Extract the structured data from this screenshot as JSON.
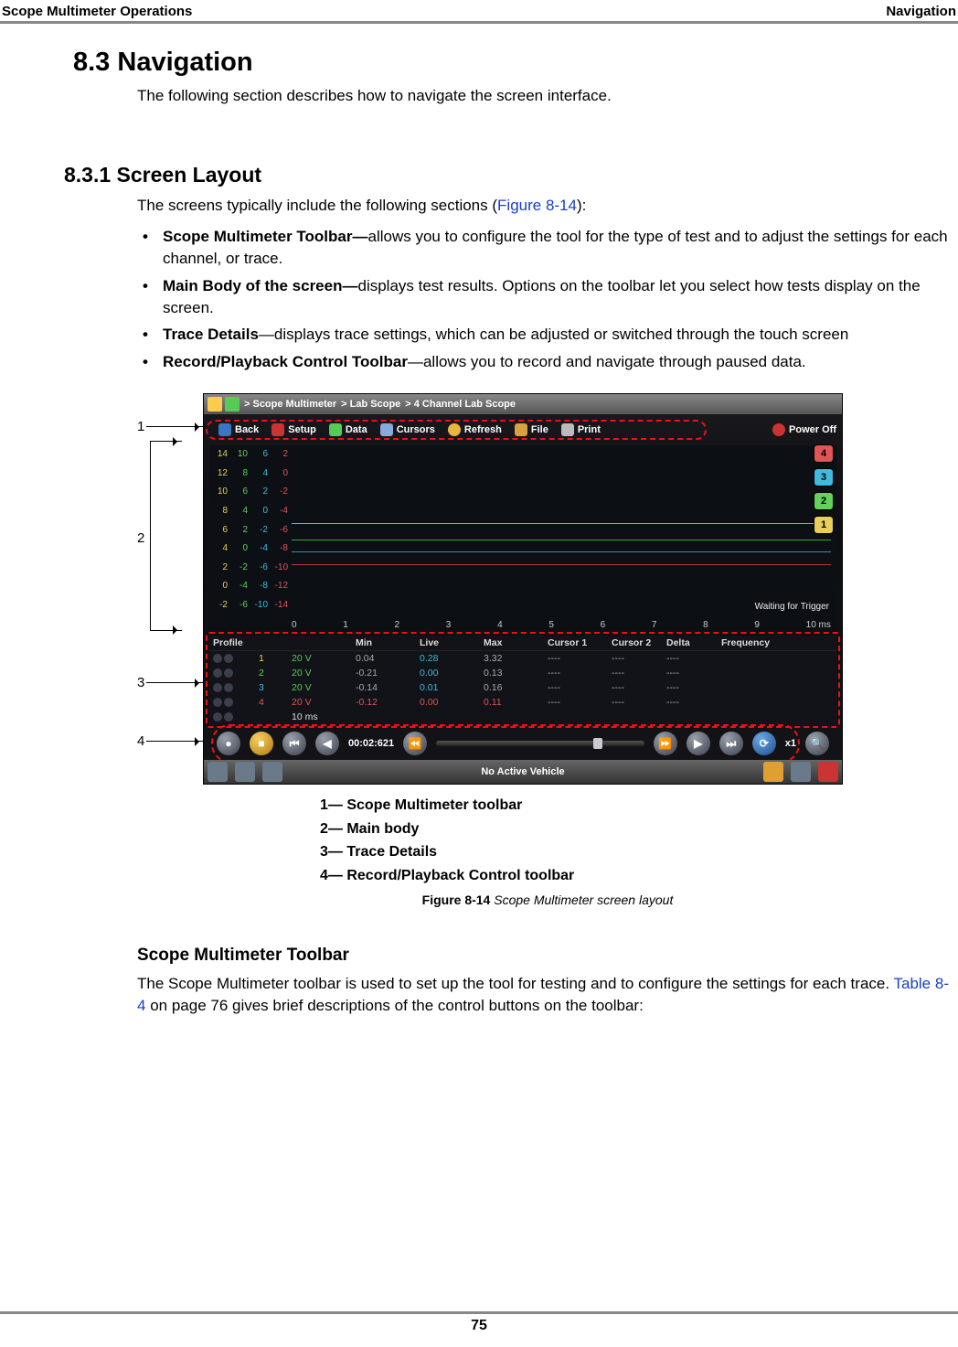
{
  "page_header": {
    "left": "Scope Multimeter Operations",
    "right": "Navigation"
  },
  "page_number": "75",
  "h_section": "8.3   Navigation",
  "p_section_intro": "The following section describes how to navigate the screen interface.",
  "h_sub": "8.3.1   Screen Layout",
  "p_sub_intro_pre": "The screens typically include the following sections (",
  "p_sub_intro_link": "Figure 8-14",
  "p_sub_intro_post": "):",
  "bullets": [
    {
      "lead": "Scope Multimeter Toolbar—",
      "rest": "allows you to configure the tool for the type of test and to adjust the settings for each channel, or trace."
    },
    {
      "lead": "Main Body of the screen—",
      "rest": "displays test results. Options on the toolbar let you select how tests display on the screen."
    },
    {
      "lead": "Trace Details",
      "rest": "—displays trace settings, which can be adjusted or switched through the touch screen"
    },
    {
      "lead": "Record/Playback Control Toolbar",
      "rest": "—allows you to record and navigate through paused data."
    }
  ],
  "callouts": {
    "1": "1",
    "2": "2",
    "3": "3",
    "4": "4"
  },
  "shot": {
    "breadcrumb": [
      "> Scope Multimeter",
      "> Lab Scope",
      "> 4 Channel Lab Scope"
    ],
    "toolbar": {
      "back": "Back",
      "setup": "Setup",
      "data": "Data",
      "cursors": "Cursors",
      "refresh": "Refresh",
      "file": "File",
      "print": "Print",
      "power": "Power Off"
    },
    "y": {
      "c1": [
        "14",
        "12",
        "10",
        "8",
        "6",
        "4",
        "2",
        "0",
        "-2"
      ],
      "c2": [
        "10",
        "8",
        "6",
        "4",
        "2",
        "0",
        "-2",
        "-4",
        "-6"
      ],
      "c3": [
        "6",
        "4",
        "2",
        "0",
        "-2",
        "-4",
        "-6",
        "-8",
        "-10"
      ],
      "c4": [
        "2",
        "0",
        "-2",
        "-4",
        "-6",
        "-8",
        "-10",
        "-12",
        "-14"
      ]
    },
    "xticks": [
      "0",
      "1",
      "2",
      "3",
      "4",
      "5",
      "6",
      "7",
      "8",
      "9",
      "10 ms"
    ],
    "waiting": "Waiting for Trigger",
    "ch_badges": [
      "4",
      "3",
      "2",
      "1"
    ],
    "trace_head": [
      "Profile",
      "",
      "",
      "Min",
      "Live",
      "Max",
      "Cursor 1",
      "Cursor 2",
      "Delta",
      "Frequency"
    ],
    "trace_rows": [
      {
        "n": "1",
        "peak": "20 V",
        "min": "0.04",
        "live": "0.28",
        "max": "3.32",
        "c1": "----",
        "c2": "----",
        "d": "----",
        "f": ""
      },
      {
        "n": "2",
        "peak": "20 V",
        "min": "-0.21",
        "live": "0.00",
        "max": "0.13",
        "c1": "----",
        "c2": "----",
        "d": "----",
        "f": ""
      },
      {
        "n": "3",
        "peak": "20 V",
        "min": "-0.14",
        "live": "0.01",
        "max": "0.16",
        "c1": "----",
        "c2": "----",
        "d": "----",
        "f": ""
      },
      {
        "n": "4",
        "peak": "20 V",
        "min": "-0.12",
        "live": "0.00",
        "max": "0.11",
        "c1": "----",
        "c2": "----",
        "d": "----",
        "f": ""
      }
    ],
    "sweep_row": {
      "label": "10 ms"
    },
    "play": {
      "time": "00:02:621",
      "zoom": "x1"
    },
    "bottom": {
      "nav": "No Active Vehicle"
    }
  },
  "legend": [
    "1— Scope Multimeter toolbar",
    "2— Main body",
    "3— Trace Details",
    "4— Record/Playback Control toolbar"
  ],
  "caption": {
    "label": "Figure 8-14 ",
    "text": "Scope Multimeter screen layout"
  },
  "h_toolbar": "Scope Multimeter Toolbar",
  "p_toolbar_pre": "The Scope Multimeter toolbar is used to set up the tool for testing and to configure the settings for each trace. ",
  "p_toolbar_link": "Table 8-4",
  "p_toolbar_post": " on page 76 gives brief descriptions of the control buttons on the toolbar:"
}
